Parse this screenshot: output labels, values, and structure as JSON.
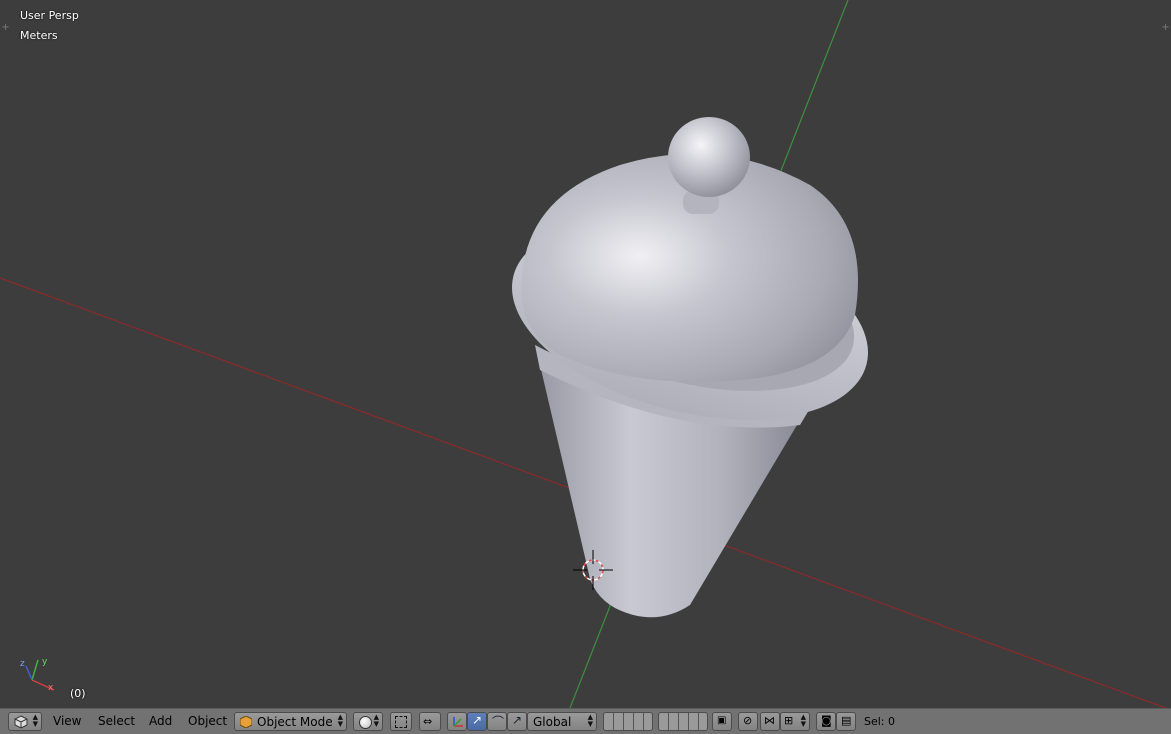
{
  "viewport": {
    "view_label": "User Persp",
    "units_label": "Meters",
    "frame_label": "(0)"
  },
  "header": {
    "menus": [
      "View",
      "Select",
      "Add",
      "Object"
    ],
    "mode": "Object Mode",
    "orientation": "Global",
    "selection": "Sel: 0"
  },
  "colors": {
    "background": "#3d3d3d",
    "header": "#727272",
    "x_axis": "#8a2a2a",
    "y_axis": "#3a8a3a",
    "mesh": "#c8c8d0"
  }
}
